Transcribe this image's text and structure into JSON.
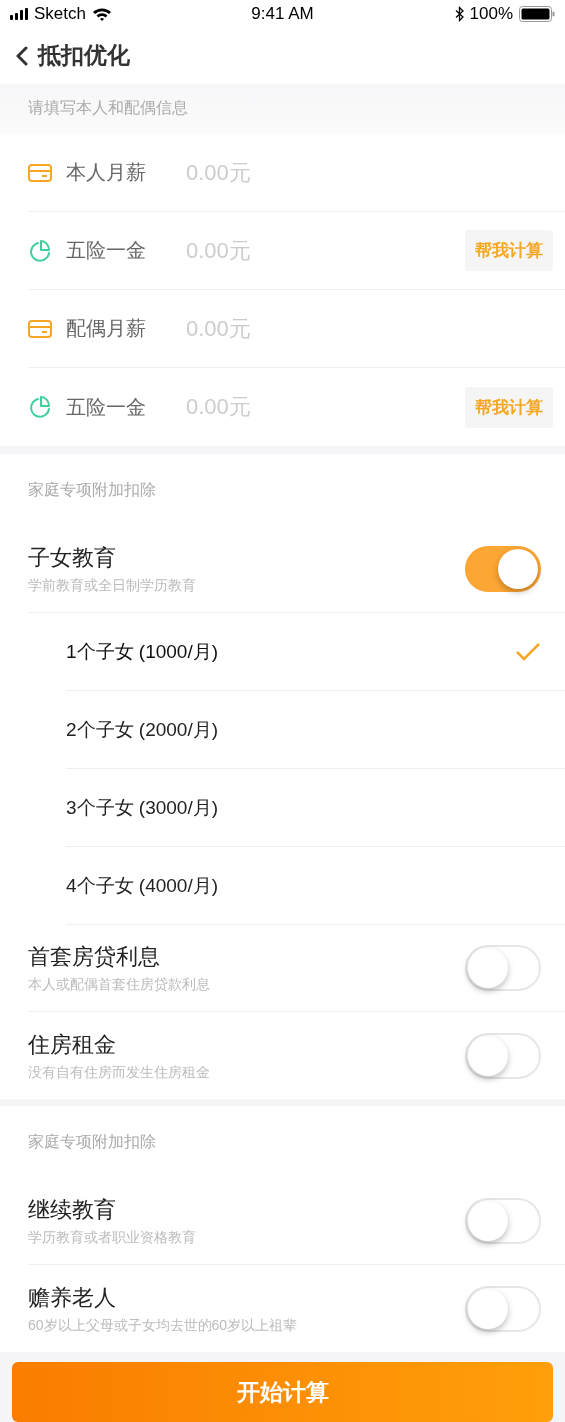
{
  "status_bar": {
    "carrier": "Sketch",
    "time": "9:41 AM",
    "battery": "100%"
  },
  "nav": {
    "title": "抵扣优化"
  },
  "income_section": {
    "header": "请填写本人和配偶信息",
    "rows": [
      {
        "kind": "card",
        "label": "本人月薪",
        "placeholder": "0.00元"
      },
      {
        "kind": "pie",
        "label": "五险一金",
        "placeholder": "0.00元",
        "action": "帮我计算"
      },
      {
        "kind": "card",
        "label": "配偶月薪",
        "placeholder": "0.00元"
      },
      {
        "kind": "pie",
        "label": "五险一金",
        "placeholder": "0.00元",
        "action": "帮我计算"
      }
    ]
  },
  "family_section": {
    "header": "家庭专项附加扣除",
    "items": [
      {
        "title": "子女教育",
        "subtitle": "学前教育或全日制学历教育",
        "on": true,
        "options": [
          {
            "label": "1个子女 (1000/月)",
            "selected": true
          },
          {
            "label": "2个子女 (2000/月)",
            "selected": false
          },
          {
            "label": "3个子女 (3000/月)",
            "selected": false
          },
          {
            "label": "4个子女 (4000/月)",
            "selected": false
          }
        ]
      },
      {
        "title": "首套房贷利息",
        "subtitle": "本人或配偶首套住房贷款利息",
        "on": false
      },
      {
        "title": "住房租金",
        "subtitle": "没有自有住房而发生住房租金",
        "on": false
      }
    ]
  },
  "other_section": {
    "header": "家庭专项附加扣除",
    "items": [
      {
        "title": "继续教育",
        "subtitle": "学历教育或者职业资格教育",
        "on": false
      },
      {
        "title": "赡养老人",
        "subtitle": "60岁以上父母或子女均去世的60岁以上祖辈",
        "on": false
      }
    ]
  },
  "submit_button": "开始计算"
}
